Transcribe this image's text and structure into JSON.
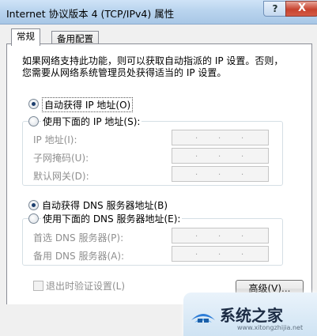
{
  "window": {
    "title": "Internet 协议版本 4 (TCP/IPv4) 属性",
    "help_label": "?",
    "close_label": "X"
  },
  "tabs": [
    {
      "label": "常规",
      "active": true
    },
    {
      "label": "备用配置",
      "active": false
    }
  ],
  "description": {
    "line1": "如果网络支持此功能，则可以获取自动指派的 IP 设置。否则，",
    "line2": "您需要从网络系统管理员处获得适当的 IP 设置。"
  },
  "ip": {
    "auto_label": "自动获得 IP 地址(O)",
    "manual_label": "使用下面的 IP 地址(S):",
    "selected": "auto",
    "fields": [
      {
        "label": "IP 地址(I):",
        "value": ". . ."
      },
      {
        "label": "子网掩码(U):",
        "value": ". . ."
      },
      {
        "label": "默认网关(D):",
        "value": ". . ."
      }
    ]
  },
  "dns": {
    "auto_label": "自动获得 DNS 服务器地址(B)",
    "manual_label": "使用下面的 DNS 服务器地址(E):",
    "selected": "auto",
    "fields": [
      {
        "label": "首选 DNS 服务器(P):",
        "value": ". . ."
      },
      {
        "label": "备用 DNS 服务器(A):",
        "value": ". . ."
      }
    ]
  },
  "validate_on_exit": {
    "label": "退出时验证设置(L)",
    "checked": false,
    "enabled": false
  },
  "advanced_button": "高级(V)...",
  "watermark": {
    "text": "系统之家",
    "url": "www.xitongzhijia.net"
  }
}
